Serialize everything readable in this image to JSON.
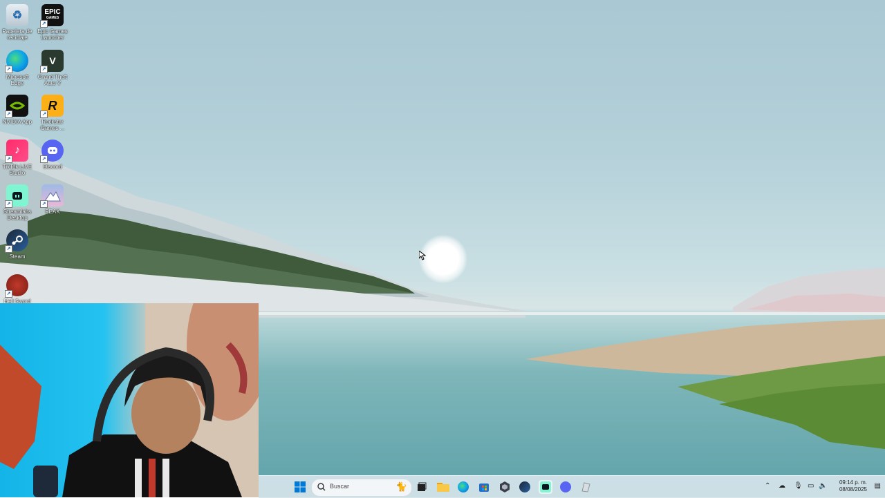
{
  "desktop_icons": [
    {
      "label": "Papelera de reciclaje",
      "icon": "recycle-bin-icon"
    },
    {
      "label": "Epic Games Launcher",
      "icon": "epic-games-icon"
    },
    {
      "label": "Microsoft Edge",
      "icon": "edge-icon"
    },
    {
      "label": "Grand Theft Auto V",
      "icon": "gta-icon"
    },
    {
      "label": "NVIDIA App",
      "icon": "nvidia-icon"
    },
    {
      "label": "Rockstar Games ...",
      "icon": "rockstar-icon"
    },
    {
      "label": "TikTok LIVE Studio",
      "icon": "tiktok-icon"
    },
    {
      "label": "Discord",
      "icon": "discord-icon"
    },
    {
      "label": "Streamlabs Desktop",
      "icon": "streamlabs-icon"
    },
    {
      "label": "PEAK",
      "icon": "peak-icon"
    },
    {
      "label": "Steam",
      "icon": "steam-icon"
    },
    {
      "label": "Hell Sword",
      "icon": "hellsword-icon"
    }
  ],
  "epic_logo_text": "EPIC",
  "epic_logo_sub": "GAMES",
  "rockstar_logo_text": "R",
  "taskbar": {
    "search_placeholder": "Buscar",
    "pinned": [
      "windows-start-icon",
      "task-view-icon",
      "file-explorer-icon",
      "edge-icon",
      "store-icon",
      "app-hexagon-icon",
      "steam-icon",
      "streamlabs-icon",
      "discord-icon",
      "generic-app-icon"
    ]
  },
  "tray": {
    "time": "09:14 p. m.",
    "date": "08/08/2025"
  },
  "colors": {
    "sky": "#a9c8d3",
    "lake": "#5ea2a9",
    "taskbar": "#d6e4ea",
    "webcam_bg": "#14b4e8",
    "windows_blue": "#0078d4"
  }
}
